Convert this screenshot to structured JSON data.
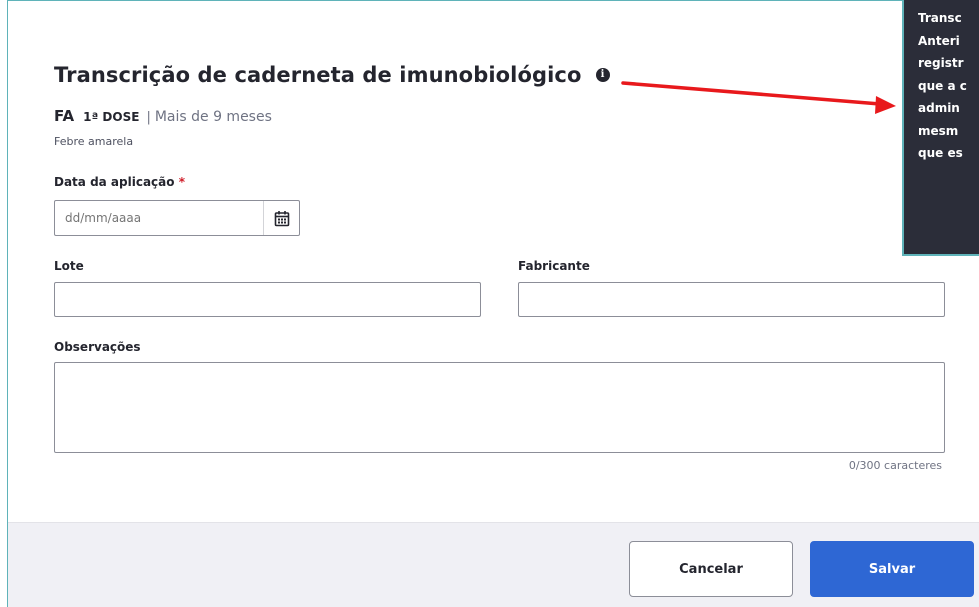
{
  "modal": {
    "title": "Transcrição de caderneta de imunobiológico",
    "vaccine_code": "FA",
    "dose": "1ª DOSE",
    "separator": "|",
    "age_group": "Mais de 9 meses",
    "vaccine_name": "Febre amarela"
  },
  "form": {
    "date_label": "Data da aplicação",
    "required_mark": "*",
    "date_placeholder": "dd/mm/aaaa",
    "lote_label": "Lote",
    "lote_value": "",
    "fabricante_label": "Fabricante",
    "fabricante_value": "",
    "obs_label": "Observações",
    "obs_value": "",
    "counter": "0/300 caracteres"
  },
  "footer": {
    "cancel_label": "Cancelar",
    "save_label": "Salvar"
  },
  "tooltip": {
    "lines": [
      "Transc",
      "Anteri",
      "registr",
      "que a c",
      "admin",
      "mesm",
      "que es"
    ]
  },
  "colors": {
    "accent": "#2e67d4",
    "annotation_arrow": "#e8191c",
    "required": "#d01e2a",
    "frame": "#5fb3b9"
  },
  "icons": {
    "info": "info-icon",
    "calendar": "calendar-icon"
  }
}
